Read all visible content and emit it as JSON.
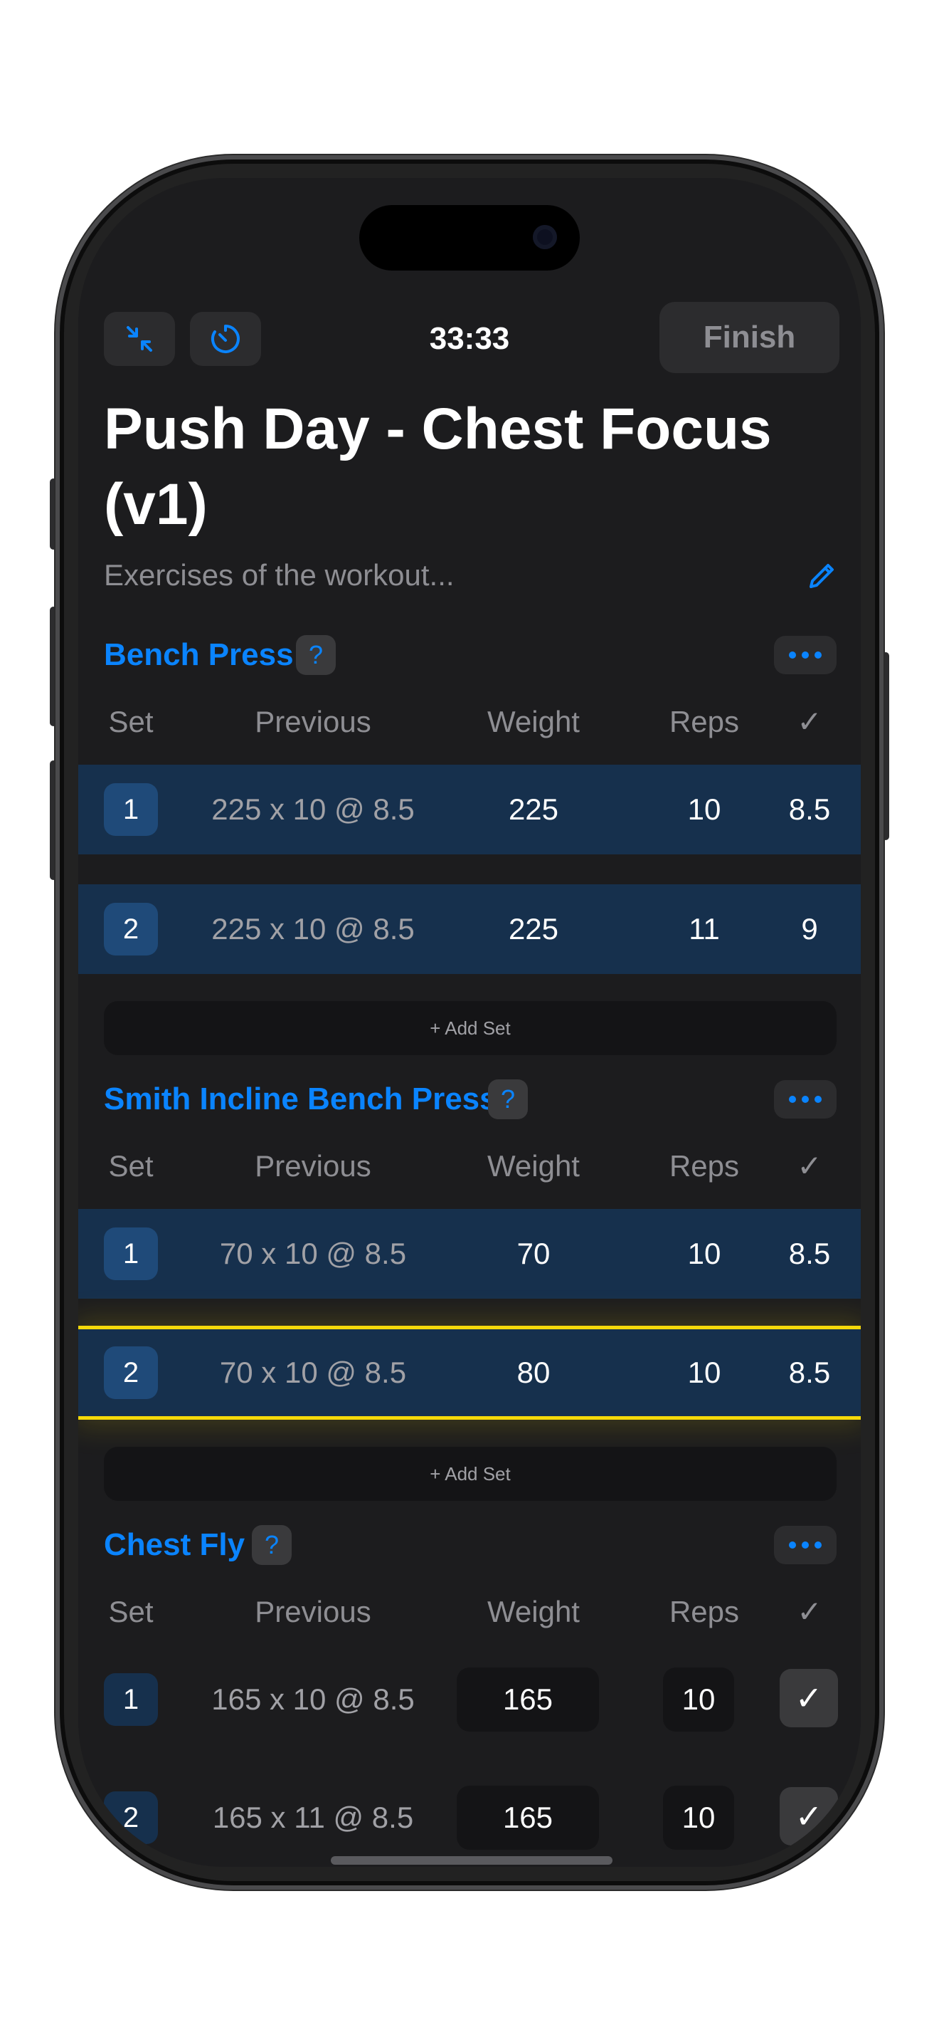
{
  "header": {
    "timer": "33:33",
    "finish_label": "Finish",
    "title": "Push Day - Chest Focus (v1)",
    "subtitle": "Exercises of the workout..."
  },
  "columns": {
    "set": "Set",
    "previous": "Previous",
    "weight": "Weight",
    "reps": "Reps",
    "check": "✓"
  },
  "add_set_label": "+ Add Set",
  "help_label": "?",
  "exercises": [
    {
      "name": "Bench Press",
      "sets": [
        {
          "set": "1",
          "previous": "225 x 10 @ 8.5",
          "weight": "225",
          "reps": "10",
          "rpe": "8.5"
        },
        {
          "set": "2",
          "previous": "225 x 10 @ 8.5",
          "weight": "225",
          "reps": "11",
          "rpe": "9"
        }
      ]
    },
    {
      "name": "Smith Incline Bench Press",
      "sets": [
        {
          "set": "1",
          "previous": "70 x 10 @ 8.5",
          "weight": "70",
          "reps": "10",
          "rpe": "8.5"
        },
        {
          "set": "2",
          "previous": "70 x 10 @ 8.5",
          "weight": "80",
          "reps": "10",
          "rpe": "8.5"
        }
      ]
    },
    {
      "name": "Chest Fly",
      "sets": [
        {
          "set": "1",
          "previous": "165 x 10 @ 8.5",
          "weight": "165",
          "reps": "10",
          "check": "✓"
        },
        {
          "set": "2",
          "previous": "165 x 11 @ 8.5",
          "weight": "165",
          "reps": "10",
          "check": "✓"
        }
      ]
    }
  ],
  "icons": {
    "minimize": "minimize-icon",
    "timer": "stopwatch-icon",
    "edit": "pencil-icon",
    "more": "ellipsis-icon"
  },
  "colors": {
    "accent": "#0a84ff",
    "highlight": "#f5d90a",
    "completed_row": "#16304d"
  }
}
